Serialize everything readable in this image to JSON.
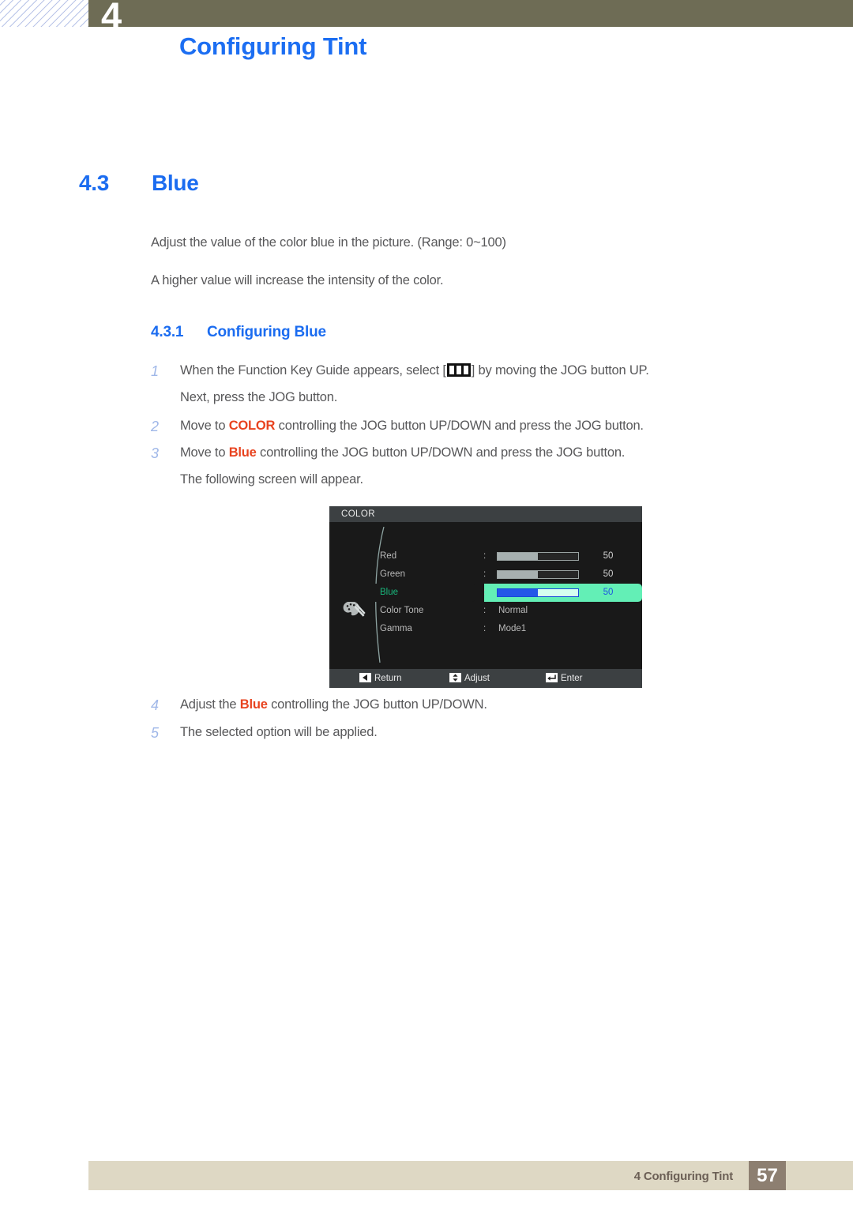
{
  "header": {
    "chapter_number": "4",
    "title": "Configuring Tint"
  },
  "section": {
    "number": "4.3",
    "title": "Blue"
  },
  "intro": {
    "line1": "Adjust the value of the color blue in the picture. (Range: 0~100)",
    "line2": "A higher value will increase the intensity of the color."
  },
  "subsection": {
    "number": "4.3.1",
    "title": "Configuring Blue"
  },
  "steps": [
    {
      "num": "1",
      "text_before": "When the Function Key Guide appears, select [",
      "icon": "function-key-guide-icon",
      "text_after": "] by moving the JOG button UP.",
      "sub": "Next, press the JOG button."
    },
    {
      "num": "2",
      "text_before": "Move to ",
      "keyword": "COLOR",
      "text_after": " controlling the JOG button UP/DOWN and press the JOG button."
    },
    {
      "num": "3",
      "text_before": "Move to ",
      "keyword": "Blue",
      "text_after": " controlling the JOG button UP/DOWN and press the JOG button.",
      "sub": "The following screen will appear."
    },
    {
      "num": "4",
      "text_before": "Adjust the ",
      "keyword": "Blue",
      "text_after": " controlling the JOG button UP/DOWN."
    },
    {
      "num": "5",
      "text_before": "The selected option will be applied."
    }
  ],
  "osd": {
    "title": "COLOR",
    "menu_icon": "palette-icon",
    "rows": [
      {
        "label": "Red",
        "colon": ":",
        "type": "slider",
        "fill_percent": 50,
        "value": "50",
        "selected": false
      },
      {
        "label": "Green",
        "colon": ":",
        "type": "slider",
        "fill_percent": 50,
        "value": "50",
        "selected": false
      },
      {
        "label": "Blue",
        "colon": ":",
        "type": "slider",
        "fill_percent": 50,
        "value": "50",
        "selected": true
      },
      {
        "label": "Color Tone",
        "colon": ":",
        "type": "text",
        "value": "Normal",
        "selected": false
      },
      {
        "label": "Gamma",
        "colon": ":",
        "type": "text",
        "value": "Mode1",
        "selected": false
      }
    ],
    "footer": [
      {
        "icon": "left-arrow-icon",
        "label": "Return"
      },
      {
        "icon": "up-down-arrow-icon",
        "label": "Adjust"
      },
      {
        "icon": "enter-arrow-icon",
        "label": "Enter"
      }
    ]
  },
  "footer": {
    "text": "4 Configuring Tint",
    "page": "57"
  },
  "colors": {
    "header_bar": "#6e6c55",
    "heading_blue": "#1b6cf0",
    "keyword_red": "#e8431f",
    "step_number": "#9fb7e8",
    "body_text": "#58585a",
    "osd_highlight": "#63efb6",
    "osd_slider_blue": "#2457e8",
    "footer_band": "#ded8c4",
    "footer_page_box": "#8d7f71"
  }
}
